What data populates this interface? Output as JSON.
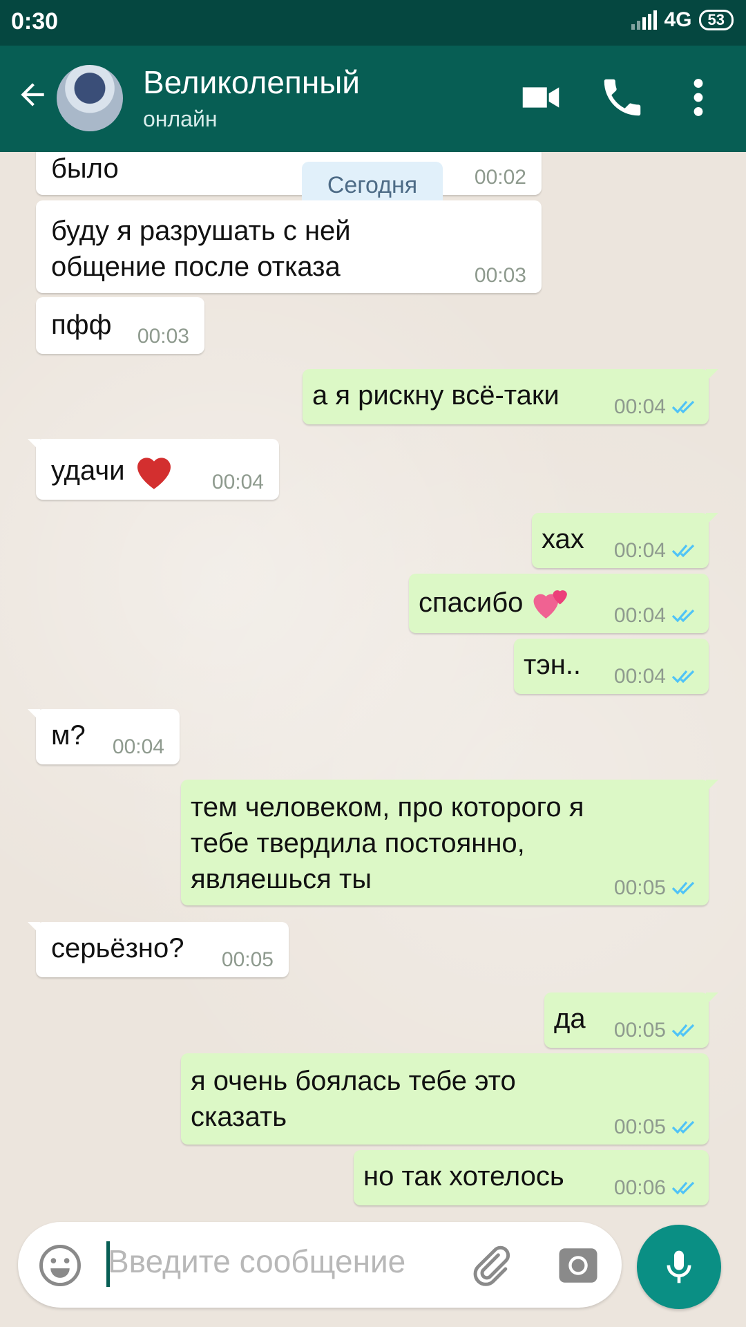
{
  "status_bar": {
    "time": "0:30",
    "network": "4G",
    "battery": "53"
  },
  "header": {
    "title": "Великолепный",
    "subtitle": "онлайн"
  },
  "date_chip": "Сегодня",
  "messages": [
    {
      "dir": "in",
      "text": "было",
      "time": "00:02"
    },
    {
      "dir": "in",
      "text": "буду я разрушать с ней общение после отказа",
      "time": "00:03"
    },
    {
      "dir": "in",
      "text": "пфф",
      "time": "00:03"
    },
    {
      "dir": "out",
      "text": "а я рискну всё-таки",
      "time": "00:04"
    },
    {
      "dir": "in",
      "text": "удачи",
      "time": "00:04"
    },
    {
      "dir": "out",
      "text": "хах",
      "time": "00:04"
    },
    {
      "dir": "out",
      "text": "спасибо",
      "time": "00:04"
    },
    {
      "dir": "out",
      "text": "тэн..",
      "time": "00:04"
    },
    {
      "dir": "in",
      "text": "м?",
      "time": "00:04"
    },
    {
      "dir": "out",
      "text": "тем человеком, про которого я тебе твердила постоянно, являешься ты",
      "time": "00:05"
    },
    {
      "dir": "in",
      "text": "серьёзно?",
      "time": "00:05"
    },
    {
      "dir": "out",
      "text": "да",
      "time": "00:05"
    },
    {
      "dir": "out",
      "text": "я очень боялась тебе это сказать",
      "time": "00:05"
    },
    {
      "dir": "out",
      "text": "но так хотелось",
      "time": "00:06"
    }
  ],
  "input": {
    "placeholder": "Введите сообщение"
  },
  "icons": {
    "back": "arrow-left-icon",
    "video": "video-camera-icon",
    "call": "phone-icon",
    "menu": "more-vert-icon",
    "emoji": "smiley-icon",
    "attach": "paperclip-icon",
    "camera": "camera-icon",
    "mic": "microphone-icon",
    "read": "double-check-icon",
    "heart": "red-heart-emoji",
    "hearts": "two-hearts-emoji"
  },
  "colors": {
    "header": "#075e54",
    "statusbar": "#054740",
    "outgoing": "#dcf8c6",
    "incoming": "#ffffff",
    "read_ticks": "#4fc3f7",
    "mic": "#0a8f84"
  }
}
